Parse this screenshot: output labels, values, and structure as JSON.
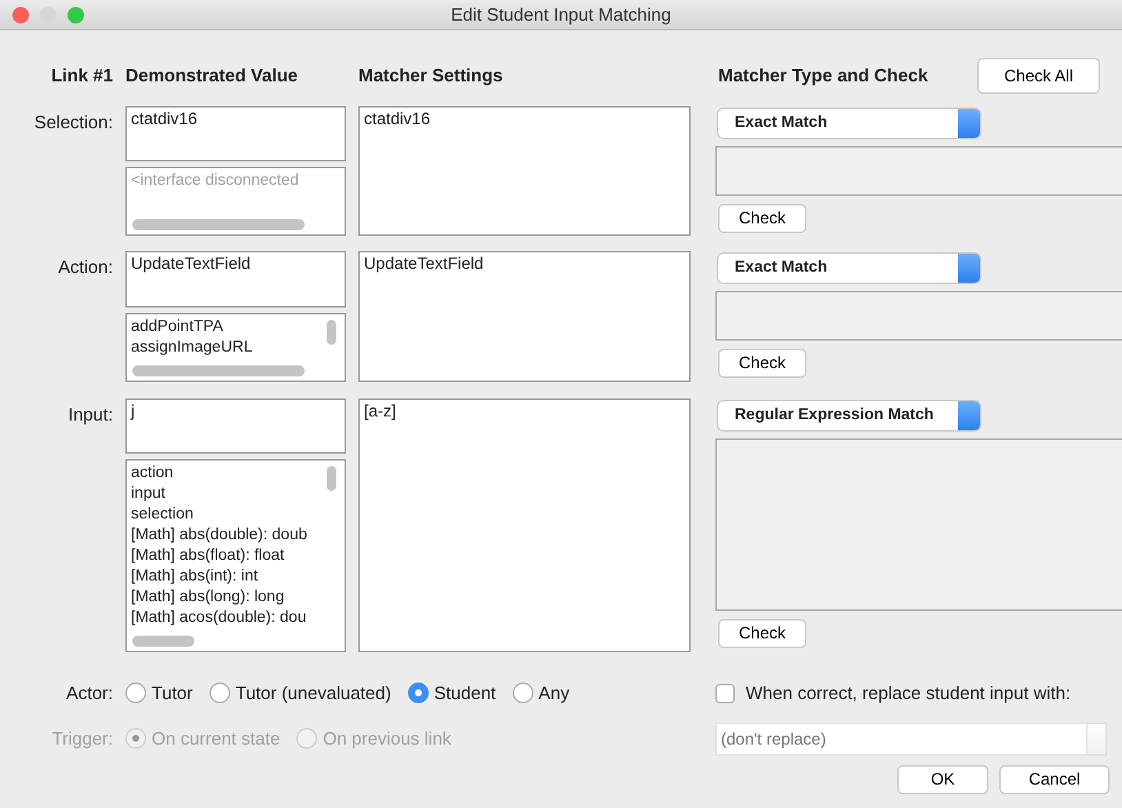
{
  "window": {
    "title": "Edit Student Input Matching"
  },
  "header": {
    "link": "Link #1",
    "columns": [
      "Demonstrated Value",
      "Matcher Settings",
      "Matcher Type and Check"
    ],
    "check_all": "Check All"
  },
  "rows": [
    {
      "label": "Selection:",
      "value": "ctatdiv16",
      "options": [
        {
          "text": "<interface disconnected",
          "disabled": true
        }
      ],
      "matcher": "ctatdiv16",
      "matcher_type": "Exact Match",
      "check": "Check"
    },
    {
      "label": "Action:",
      "value": "UpdateTextField",
      "options": [
        {
          "text": "addPointTPA",
          "disabled": false
        },
        {
          "text": "assignImageURL",
          "disabled": false
        }
      ],
      "matcher": "UpdateTextField",
      "matcher_type": "Exact Match",
      "check": "Check"
    },
    {
      "label": "Input:",
      "value": "j",
      "options": [
        {
          "text": "action",
          "disabled": false
        },
        {
          "text": "input",
          "disabled": false
        },
        {
          "text": "selection",
          "disabled": false
        },
        {
          "text": "[Math] abs(double): doub",
          "disabled": false
        },
        {
          "text": "[Math] abs(float): float",
          "disabled": false
        },
        {
          "text": "[Math] abs(int): int",
          "disabled": false
        },
        {
          "text": "[Math] abs(long): long",
          "disabled": false
        },
        {
          "text": "[Math] acos(double): dou",
          "disabled": false
        }
      ],
      "matcher": "[a-z]",
      "matcher_type": "Regular Expression Match",
      "check": "Check"
    }
  ],
  "actor": {
    "label": "Actor:",
    "options": [
      {
        "label": "Tutor",
        "selected": false
      },
      {
        "label": "Tutor (unevaluated)",
        "selected": false
      },
      {
        "label": "Student",
        "selected": true
      },
      {
        "label": "Any",
        "selected": false
      }
    ]
  },
  "trigger": {
    "label": "Trigger:",
    "disabled": true,
    "options": [
      {
        "label": "On current state",
        "selected": true
      },
      {
        "label": "On previous link",
        "selected": false
      }
    ]
  },
  "replace": {
    "label": "When correct, replace student input with:",
    "checked": false,
    "placeholder": "(don't replace)",
    "disabled": true
  },
  "buttons": [
    "OK",
    "Cancel"
  ]
}
